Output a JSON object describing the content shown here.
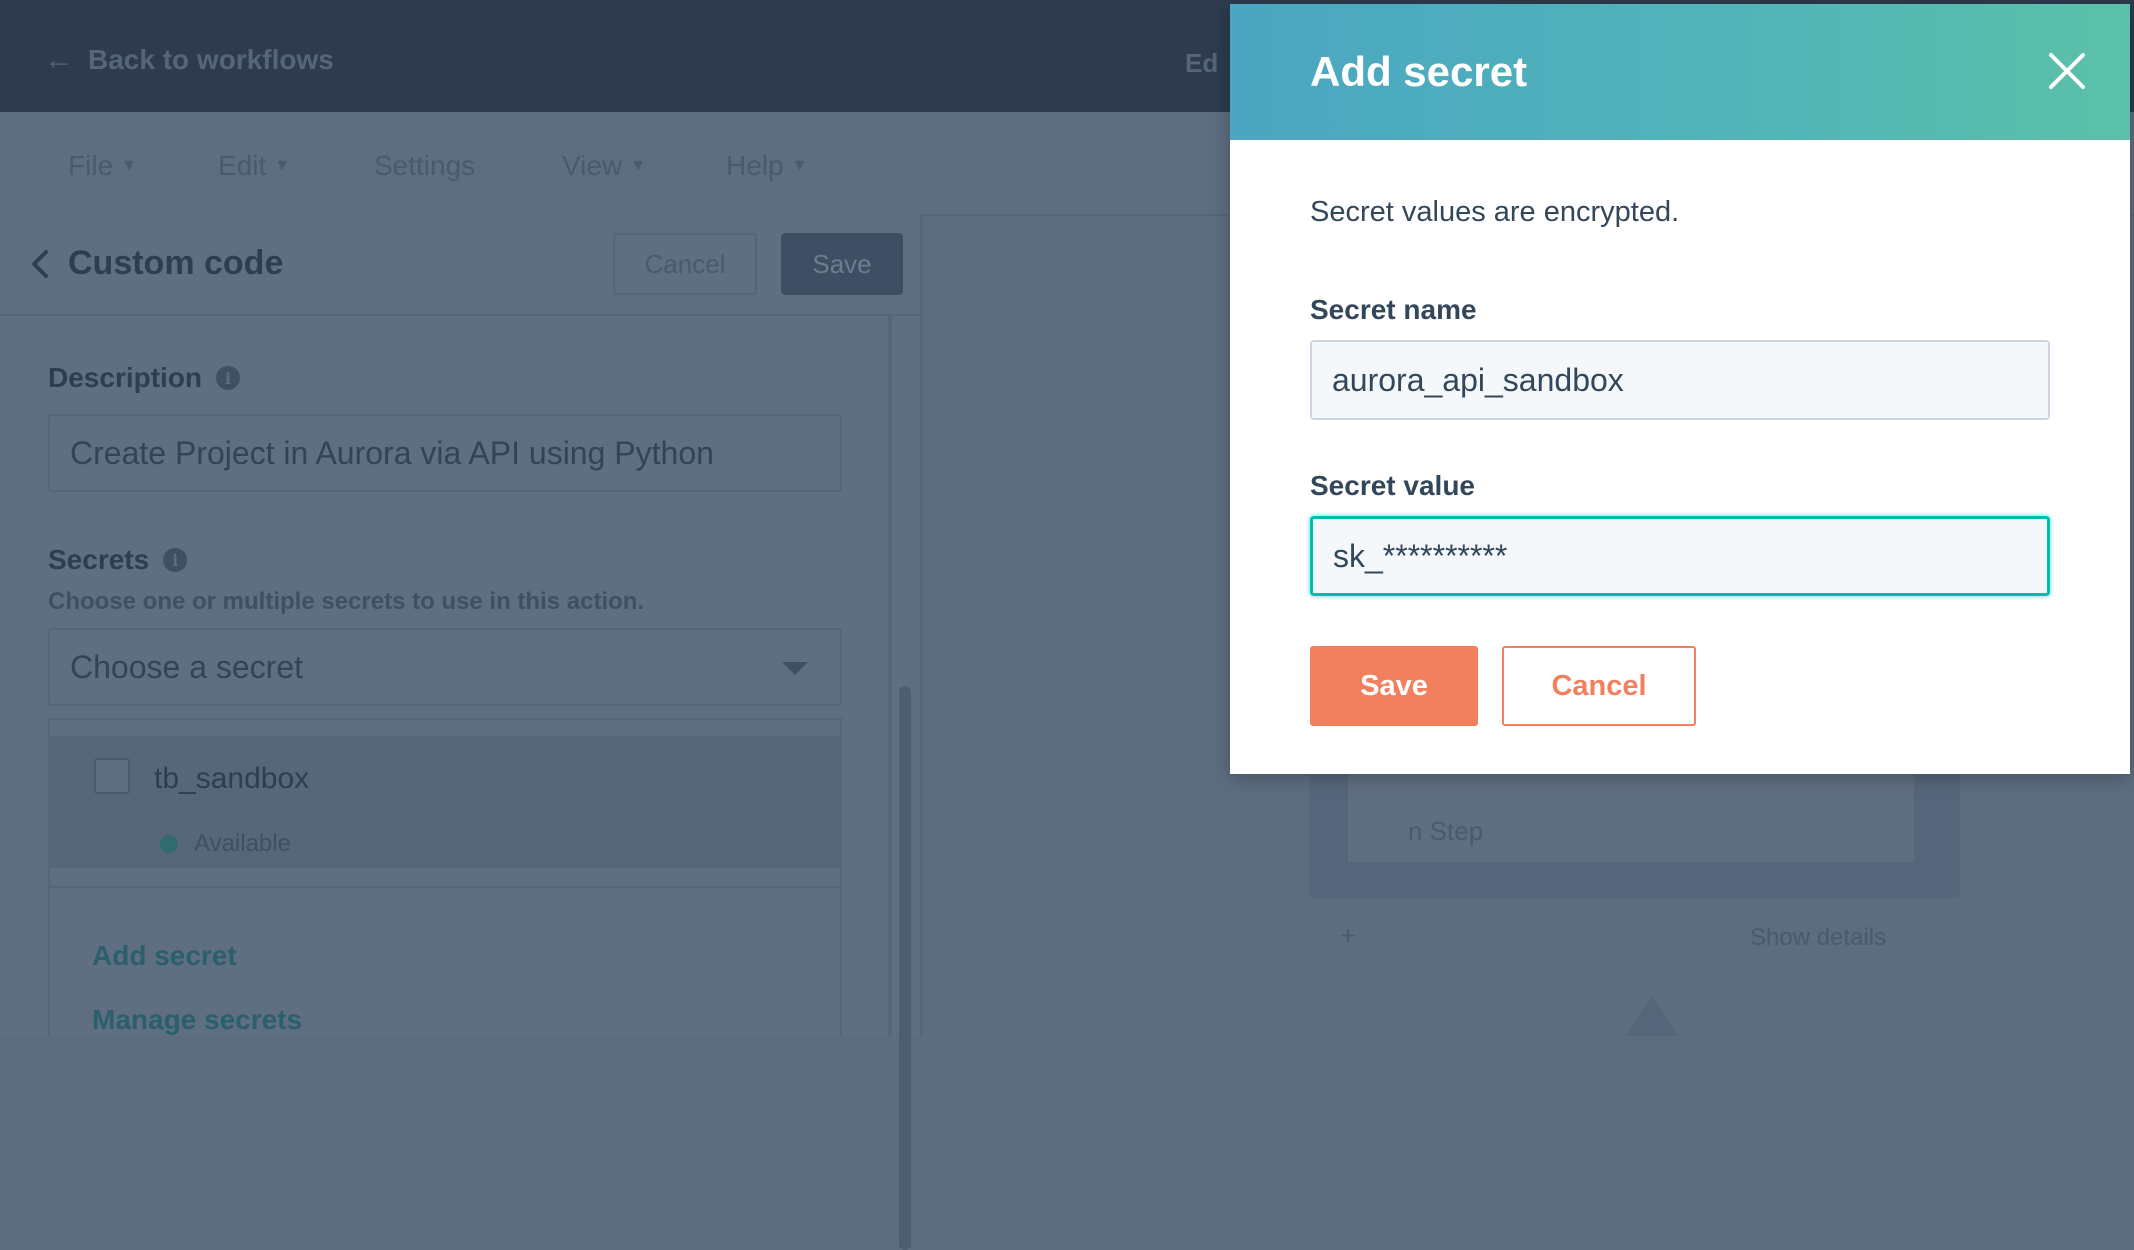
{
  "background": {
    "topbar": {
      "back_label": "Back to workflows",
      "right_text": "Ed"
    },
    "menubar": {
      "items": [
        {
          "label": "File",
          "has_menu": true
        },
        {
          "label": "Edit",
          "has_menu": true
        },
        {
          "label": "Settings",
          "has_menu": false
        },
        {
          "label": "View",
          "has_menu": true
        },
        {
          "label": "Help",
          "has_menu": true
        }
      ]
    },
    "panel": {
      "title": "Custom code",
      "cancel_label": "Cancel",
      "save_label": "Save",
      "description_label": "Description",
      "description_value": "Create Project in Aurora via API using Python",
      "secrets_label": "Secrets",
      "secrets_helper": "Choose one or multiple secrets to use in this action.",
      "secrets_select_placeholder": "Choose a secret",
      "secret_options": [
        {
          "name": "tb_sandbox",
          "status": "Available"
        }
      ],
      "add_secret_link": "Add secret",
      "manage_secrets_link": "Manage secrets"
    },
    "workflow": {
      "card_text": "n Step",
      "footer_plus": "+",
      "footer_details": "Show details"
    }
  },
  "modal": {
    "title": "Add secret",
    "description": "Secret values are encrypted.",
    "name_label": "Secret name",
    "name_value": "aurora_api_sandbox",
    "value_label": "Secret value",
    "value_value": "sk_**********",
    "save_label": "Save",
    "cancel_label": "Cancel"
  },
  "colors": {
    "header_gradient_start": "#4aa6c1",
    "header_gradient_end": "#5bc1a8",
    "primary_button": "#f2805f",
    "focus_border": "#00bda5",
    "text": "#33475b",
    "overlay": "#5d6d80"
  }
}
